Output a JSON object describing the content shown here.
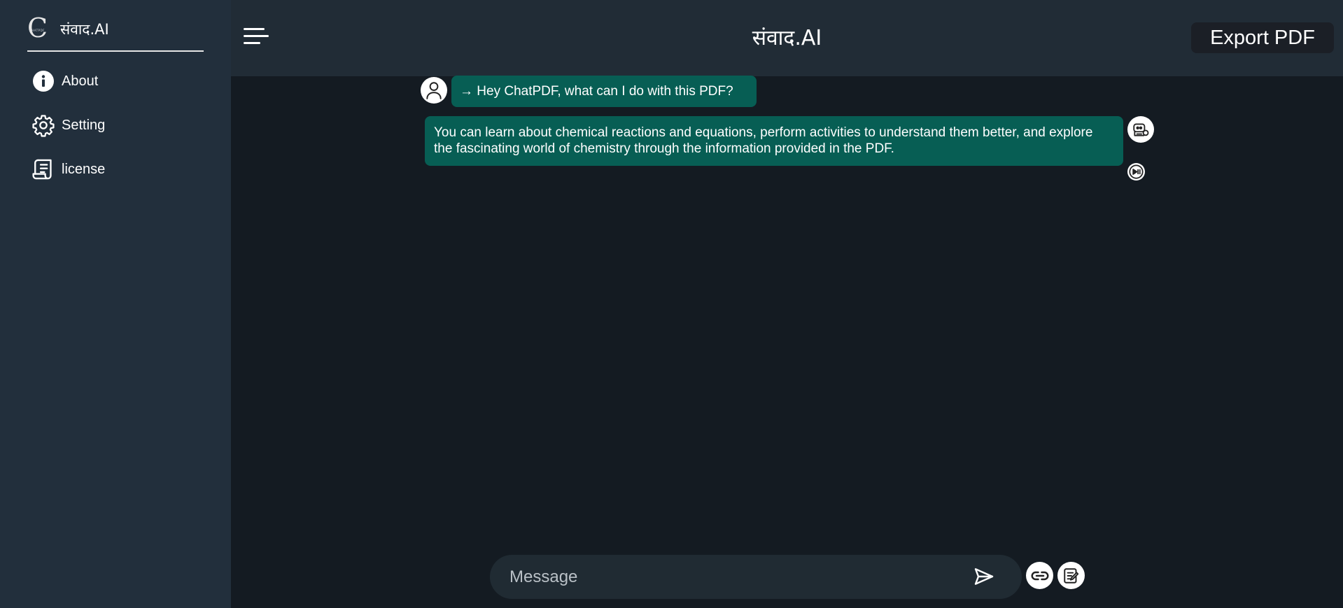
{
  "app": {
    "brand_name": "संवाद.AI",
    "logo_letter": "C",
    "logo_text": "CHATPDF"
  },
  "sidebar": {
    "items": [
      {
        "label": "About",
        "icon": "info-icon"
      },
      {
        "label": "Setting",
        "icon": "gear-icon"
      },
      {
        "label": "license",
        "icon": "document-icon"
      }
    ]
  },
  "header": {
    "title": "संवाद.AI",
    "export_label": "Export PDF",
    "menu_icon": "hamburger-icon"
  },
  "chat": {
    "messages": [
      {
        "role": "user",
        "text": "→ Hey ChatPDF, what can I do with this PDF?"
      },
      {
        "role": "bot",
        "text": "You can learn about chemical reactions and equations, perform activities to understand them better, and explore the fascinating world of chemistry through the information provided in the PDF."
      }
    ],
    "bot_controls": {
      "play_icon": "play-pause-icon"
    }
  },
  "composer": {
    "placeholder": "Message",
    "send_icon": "send-icon",
    "attach_icon": "link-icon",
    "edit_icon": "edit-note-icon"
  },
  "colors": {
    "sidebar_bg": "#222f3c",
    "header_bg": "#212c36",
    "main_bg": "#141b22",
    "bubble": "#075e54",
    "export_bg": "#1b1f26"
  }
}
